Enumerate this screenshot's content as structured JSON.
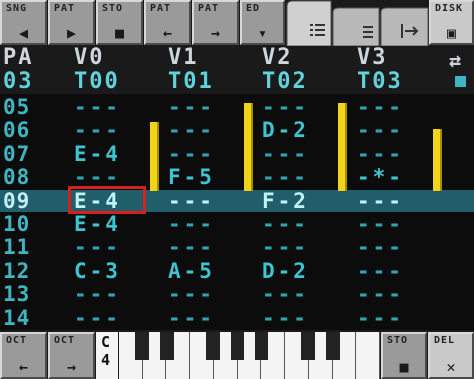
{
  "toolbar": {
    "buttons": [
      {
        "label": "SNG",
        "icon": "◀"
      },
      {
        "label": "PAT",
        "icon": "▶"
      },
      {
        "label": "STO",
        "icon": "■"
      },
      {
        "label": "PAT",
        "icon": "←"
      },
      {
        "label": "PAT",
        "icon": "→"
      },
      {
        "label": "ED",
        "icon": "▾"
      },
      {
        "label": "DISK",
        "icon": "▣"
      }
    ]
  },
  "header": {
    "pattern_label": "PA",
    "pattern_value": "03",
    "voices": [
      {
        "label": "V0",
        "track": "T00"
      },
      {
        "label": "V1",
        "track": "T01"
      },
      {
        "label": "V2",
        "track": "T02"
      },
      {
        "label": "V3",
        "track": "T03"
      }
    ],
    "link_icon": "⇄"
  },
  "rows": [
    {
      "num": "05",
      "cells": [
        "---",
        "---",
        "---",
        "---"
      ]
    },
    {
      "num": "06",
      "cells": [
        "---",
        "---",
        "D-2",
        "---"
      ]
    },
    {
      "num": "07",
      "cells": [
        "E-4",
        "---",
        "---",
        "---"
      ]
    },
    {
      "num": "08",
      "cells": [
        "---",
        "F-5",
        "---",
        "-*-"
      ]
    },
    {
      "num": "09",
      "cells": [
        "E-4",
        "---",
        "F-2",
        "---"
      ]
    },
    {
      "num": "10",
      "cells": [
        "E-4",
        "---",
        "---",
        "---"
      ]
    },
    {
      "num": "11",
      "cells": [
        "---",
        "---",
        "---",
        "---"
      ]
    },
    {
      "num": "12",
      "cells": [
        "C-3",
        "A-5",
        "D-2",
        "---"
      ]
    },
    {
      "num": "13",
      "cells": [
        "---",
        "---",
        "---",
        "---"
      ]
    },
    {
      "num": "14",
      "cells": [
        "---",
        "---",
        "---",
        "---"
      ]
    }
  ],
  "levels": [
    0.78,
    1.0,
    1.0,
    0.7
  ],
  "bottom": {
    "oct_down": {
      "label": "OCT",
      "icon": "←"
    },
    "oct_up": {
      "label": "OCT",
      "icon": "→"
    },
    "octave_note": "C",
    "octave_num": "4",
    "sto": {
      "label": "STO",
      "icon": "■"
    },
    "del": {
      "label": "DEL",
      "icon": "✕"
    }
  },
  "colors": {
    "accent": "#3fb5c2",
    "level": "#f1d41a",
    "cursor": "#d42020",
    "selected_row": "#1f5e6a"
  }
}
